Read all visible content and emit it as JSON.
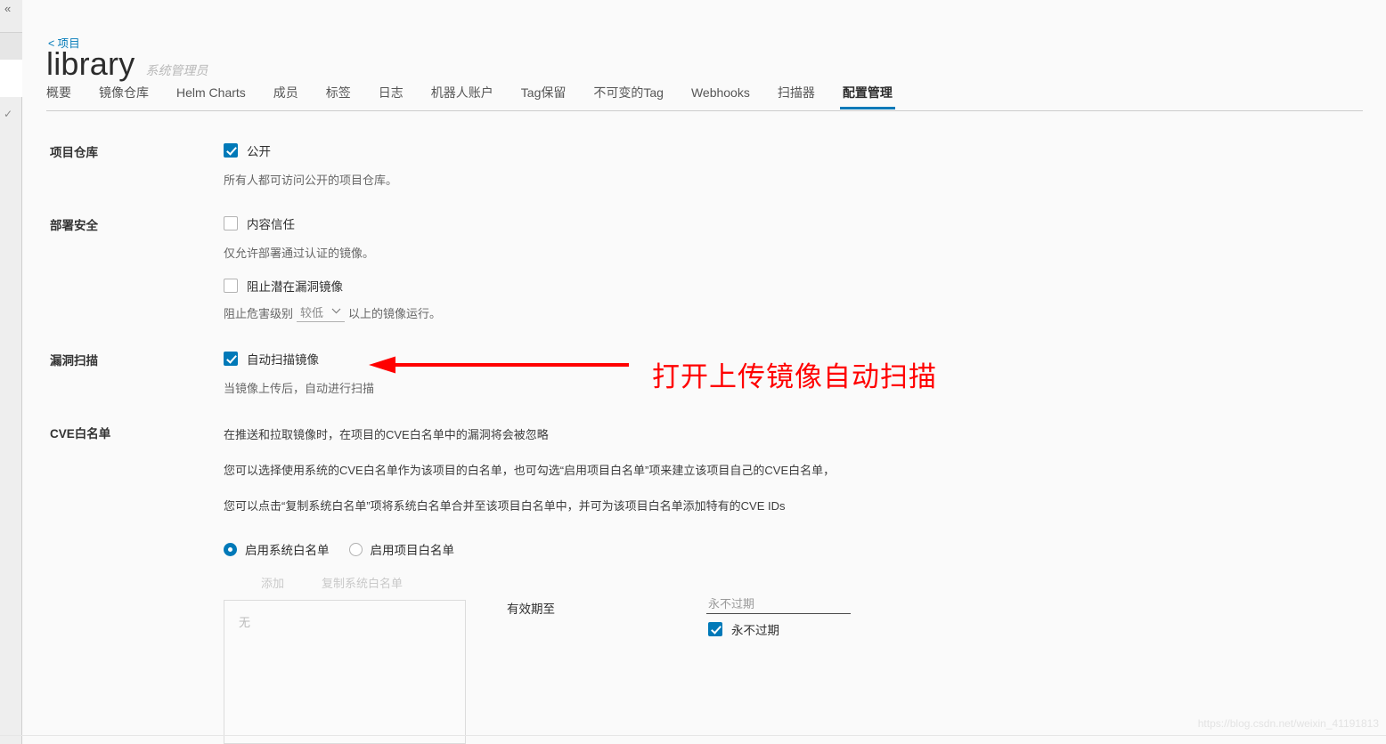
{
  "breadcrumb": {
    "chevron": "<",
    "label": "项目"
  },
  "header": {
    "title": "library",
    "subtitle": "系统管理员"
  },
  "tabs": [
    {
      "label": "概要",
      "active": false
    },
    {
      "label": "镜像仓库",
      "active": false
    },
    {
      "label": "Helm Charts",
      "active": false
    },
    {
      "label": "成员",
      "active": false
    },
    {
      "label": "标签",
      "active": false
    },
    {
      "label": "日志",
      "active": false
    },
    {
      "label": "机器人账户",
      "active": false
    },
    {
      "label": "Tag保留",
      "active": false
    },
    {
      "label": "不可变的Tag",
      "active": false
    },
    {
      "label": "Webhooks",
      "active": false
    },
    {
      "label": "扫描器",
      "active": false
    },
    {
      "label": "配置管理",
      "active": true
    }
  ],
  "sections": {
    "repository": {
      "label": "项目仓库",
      "public_checkbox": {
        "label": "公开",
        "checked": true
      },
      "public_hint": "所有人都可访问公开的项目仓库。"
    },
    "deploy_security": {
      "label": "部署安全",
      "content_trust": {
        "label": "内容信任",
        "checked": false
      },
      "content_trust_hint": "仅允许部署通过认证的镜像。",
      "prevent_vulnerable": {
        "label": "阻止潜在漏洞镜像",
        "checked": false
      },
      "severity_prefix": "阻止危害级别",
      "severity_value": "较低",
      "severity_suffix": "以上的镜像运行。"
    },
    "vulnerability_scan": {
      "label": "漏洞扫描",
      "auto_scan": {
        "label": "自动扫描镜像",
        "checked": true
      },
      "auto_scan_hint": "当镜像上传后，自动进行扫描"
    },
    "cve_whitelist": {
      "label": "CVE白名单",
      "desc_1": "在推送和拉取镜像时，在项目的CVE白名单中的漏洞将会被忽略",
      "desc_2": "您可以选择使用系统的CVE白名单作为该项目的白名单，也可勾选“启用项目白名单”项来建立该项目自己的CVE白名单，",
      "desc_3": "您可以点击“复制系统白名单”项将系统白名单合并至该项目白名单中，并可为该项目白名单添加特有的CVE IDs",
      "radios": [
        {
          "label": "启用系统白名单",
          "selected": true
        },
        {
          "label": "启用项目白名单",
          "selected": false
        }
      ],
      "add_link": "添加",
      "copy_link": "复制系统白名单",
      "list_empty": "无",
      "expiry_label": "有效期至",
      "expiry_placeholder": "永不过期",
      "expiry_value": "",
      "never_expire": {
        "label": "永不过期",
        "checked": true
      }
    }
  },
  "annotation": {
    "text": "打开上传镜像自动扫描",
    "color": "#ff0000"
  },
  "watermark": "https://blog.csdn.net/weixin_41191813",
  "colors": {
    "accent": "#0079b8",
    "link": "#0079b8",
    "annotation": "#ff0000",
    "page_bg": "#fafafa"
  },
  "icons": {
    "rail_collapse": "«",
    "rail_check": "✓",
    "chevron_down": "⌄"
  }
}
